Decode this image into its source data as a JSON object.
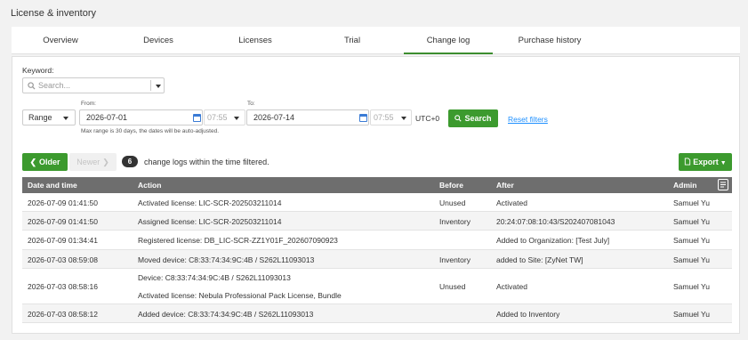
{
  "header": {
    "title": "License & inventory"
  },
  "tabs": [
    "Overview",
    "Devices",
    "Licenses",
    "Trial",
    "Change log",
    "Purchase history"
  ],
  "filters": {
    "keyword_label": "Keyword:",
    "search_placeholder": "Search...",
    "range_value": "Range",
    "from_label": "From:",
    "from_date": "2026-07-01",
    "from_time": "07:55",
    "to_label": "To:",
    "to_date": "2026-07-14",
    "to_time": "07:55",
    "timezone": "UTC+0",
    "search_button": "Search",
    "reset_link": "Reset filters",
    "hint": "Max range is 30 days, the dates will be auto-adjusted."
  },
  "pager": {
    "older": "Older",
    "newer": "Newer",
    "count": "6",
    "summary": "change logs within the time filtered.",
    "export": "Export"
  },
  "table": {
    "columns": [
      "Date and time",
      "Action",
      "Before",
      "After",
      "Admin"
    ],
    "rows": [
      {
        "date": "2026-07-09 01:41:50",
        "action": "Activated license: LIC-SCR-202503211014",
        "action2": "",
        "before": "Unused",
        "after": "Activated",
        "admin": "Samuel Yu"
      },
      {
        "date": "2026-07-09 01:41:50",
        "action": "Assigned license: LIC-SCR-202503211014",
        "action2": "",
        "before": "Inventory",
        "after": "20:24:07:08:10:43/S202407081043",
        "admin": "Samuel Yu"
      },
      {
        "date": "2026-07-09 01:34:41",
        "action": "Registered license: DB_LIC-SCR-ZZ1Y01F_202607090923",
        "action2": "",
        "before": "",
        "after": "Added to Organization: [Test July]",
        "admin": "Samuel Yu"
      },
      {
        "date": "2026-07-03 08:59:08",
        "action": "Moved device: C8:33:74:34:9C:4B / S262L11093013",
        "action2": "",
        "before": "Inventory",
        "after": "added to Site: [ZyNet TW]",
        "admin": "Samuel Yu"
      },
      {
        "date": "2026-07-03 08:58:16",
        "action": "Device: C8:33:74:34:9C:4B / S262L11093013",
        "action2": "Activated license: Nebula Professional Pack License, Bundle",
        "before": "Unused",
        "after": "Activated",
        "admin": "Samuel Yu"
      },
      {
        "date": "2026-07-03 08:58:12",
        "action": "Added device: C8:33:74:34:9C:4B / S262L11093013",
        "action2": "",
        "before": "",
        "after": "Added to Inventory",
        "admin": "Samuel Yu"
      }
    ]
  }
}
